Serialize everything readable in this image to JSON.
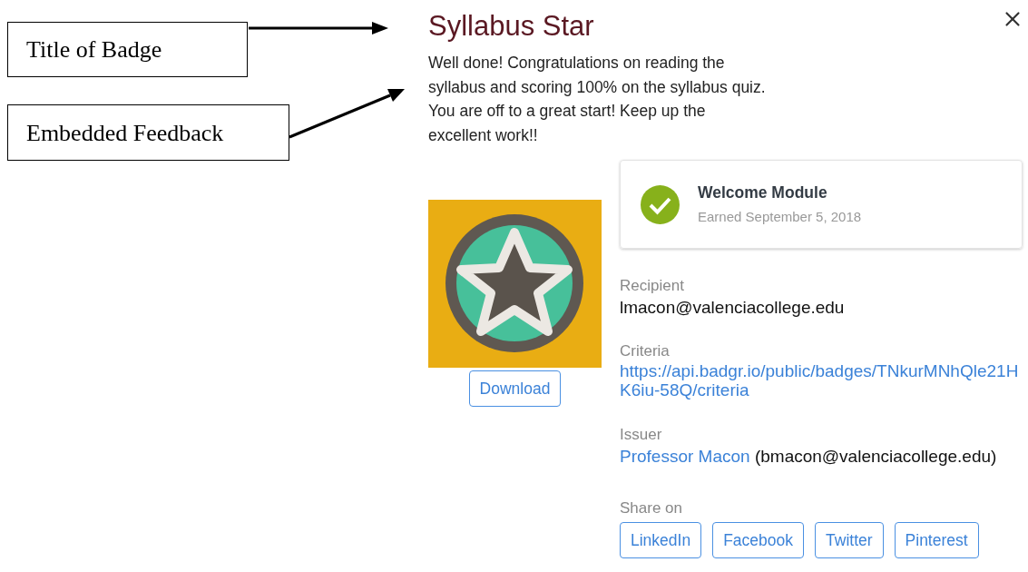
{
  "annotations": [
    {
      "label": "Title of Badge"
    },
    {
      "label": "Embedded Feedback"
    }
  ],
  "badge": {
    "title": "Syllabus Star",
    "feedback": "Well done! Congratulations on reading the syllabus and scoring 100% on the syllabus quiz. You are off to a great start! Keep up the excellent work!!",
    "download": "Download"
  },
  "module": {
    "name": "Welcome Module",
    "earned": "Earned September 5, 2018",
    "completed": true
  },
  "recipient": {
    "label": "Recipient",
    "value": "lmacon@valenciacollege.edu"
  },
  "criteria": {
    "label": "Criteria",
    "link": "https://api.badgr.io/public/badges/TNkurMNhQle21HK6iu-58Q/criteria"
  },
  "issuer": {
    "label": "Issuer",
    "name": "Professor Macon",
    "email": "(bmacon@valenciacollege.edu)"
  },
  "share": {
    "label": "Share on",
    "buttons": [
      "LinkedIn",
      "Facebook",
      "Twitter",
      "Pinterest"
    ]
  }
}
